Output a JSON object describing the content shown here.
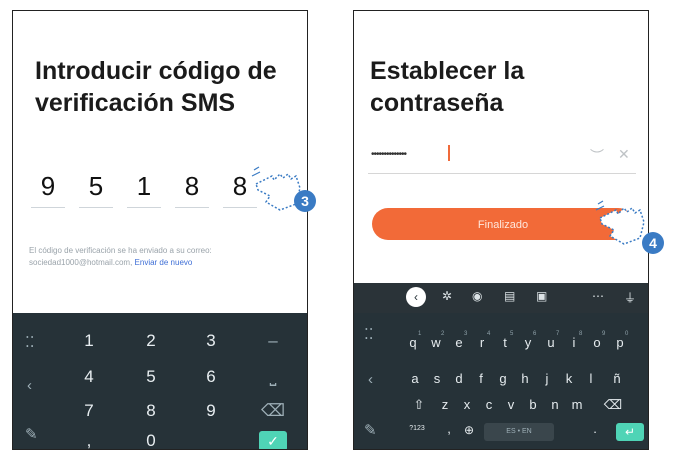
{
  "left_screen": {
    "title_line1": "Introducir código de",
    "title_line2": "verificación SMS",
    "code_digits": [
      "9",
      "5",
      "1",
      "8",
      "8"
    ],
    "hint_text": "El código de verificación se ha enviado a su correo:",
    "hint_email": "sociedad1000@hotmail.com,",
    "resend_link": "Enviar de nuevo",
    "keypad": {
      "rows": [
        [
          "1",
          "2",
          "3",
          "–"
        ],
        [
          "4",
          "5",
          "6",
          "⎵"
        ],
        [
          "7",
          "8",
          "9",
          "⌫"
        ],
        [
          ",",
          "0",
          "",
          "✓"
        ]
      ]
    },
    "step_badge": "3"
  },
  "right_screen": {
    "title_line1": "Establecer la",
    "title_line2": "contraseña",
    "password_value": "••••••••••••••",
    "finish_button": "Finalizado",
    "keyboard": {
      "row1": [
        "q",
        "w",
        "e",
        "r",
        "t",
        "y",
        "u",
        "i",
        "o",
        "p"
      ],
      "row1_sup": [
        "1",
        "2",
        "3",
        "4",
        "5",
        "6",
        "7",
        "8",
        "9",
        "0"
      ],
      "row2": [
        "a",
        "s",
        "d",
        "f",
        "g",
        "h",
        "j",
        "k",
        "l",
        "ñ"
      ],
      "row3": [
        "z",
        "x",
        "c",
        "v",
        "b",
        "n",
        "m"
      ],
      "symbols_key": "?123",
      "comma_key": ",",
      "space_label": "ES • EN",
      "period_key": "."
    },
    "step_badge": "4"
  },
  "colors": {
    "accent_orange": "#f26a38",
    "keyboard_bg": "#263238",
    "check_green": "#4fd4b6",
    "badge_blue": "#3a7bc4"
  }
}
